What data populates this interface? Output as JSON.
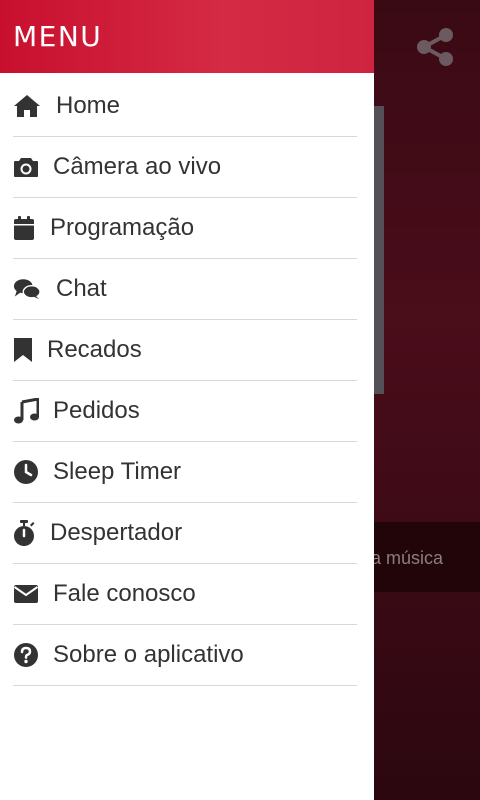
{
  "background": {
    "share_icon": "share-icon",
    "bottom_bar_text": "a música"
  },
  "drawer": {
    "title": "MENU",
    "items": [
      {
        "label": "Home",
        "icon": "home-icon"
      },
      {
        "label": "Câmera ao vivo",
        "icon": "camera-icon"
      },
      {
        "label": "Programação",
        "icon": "calendar-icon"
      },
      {
        "label": "Chat",
        "icon": "chat-icon"
      },
      {
        "label": "Recados",
        "icon": "bookmark-icon"
      },
      {
        "label": "Pedidos",
        "icon": "music-note-icon"
      },
      {
        "label": "Sleep Timer",
        "icon": "clock-icon"
      },
      {
        "label": "Despertador",
        "icon": "stopwatch-icon"
      },
      {
        "label": "Fale conosco",
        "icon": "envelope-icon"
      },
      {
        "label": "Sobre o aplicativo",
        "icon": "question-circle-icon"
      }
    ]
  },
  "colors": {
    "header_accent": "#c8102e",
    "icon": "#333333",
    "text": "#333333",
    "divider": "#d8d8d8"
  }
}
